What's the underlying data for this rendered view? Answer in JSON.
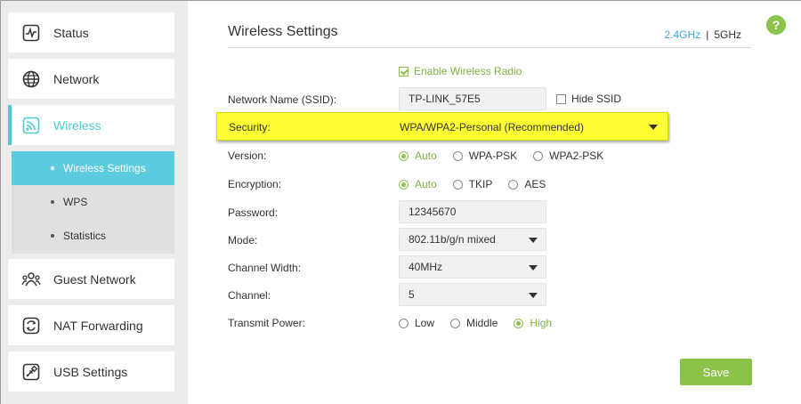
{
  "sidebar": {
    "items": [
      {
        "label": "Status",
        "icon": "status-icon"
      },
      {
        "label": "Network",
        "icon": "globe-icon"
      },
      {
        "label": "Wireless",
        "icon": "wifi-icon"
      },
      {
        "label": "Guest Network",
        "icon": "guest-icon"
      },
      {
        "label": "NAT Forwarding",
        "icon": "nat-icon"
      },
      {
        "label": "USB Settings",
        "icon": "usb-icon"
      }
    ],
    "submenu": [
      {
        "label": "Wireless Settings"
      },
      {
        "label": "WPS"
      },
      {
        "label": "Statistics"
      }
    ]
  },
  "header": {
    "title": "Wireless Settings",
    "band_24": "2.4GHz",
    "band_sep": "|",
    "band_5": "5GHz",
    "help": "?"
  },
  "form": {
    "enable_wireless": "Enable Wireless Radio",
    "ssid_label": "Network Name (SSID):",
    "ssid_value": "TP-LINK_57E5",
    "hide_ssid": "Hide SSID",
    "security_label": "Security:",
    "security_value": "WPA/WPA2-Personal (Recommended)",
    "version_label": "Version:",
    "version_options": [
      "Auto",
      "WPA-PSK",
      "WPA2-PSK"
    ],
    "encryption_label": "Encryption:",
    "encryption_options": [
      "Auto",
      "TKIP",
      "AES"
    ],
    "password_label": "Password:",
    "password_value": "12345670",
    "mode_label": "Mode:",
    "mode_value": "802.11b/g/n mixed",
    "channel_width_label": "Channel Width:",
    "channel_width_value": "40MHz",
    "channel_label": "Channel:",
    "channel_value": "5",
    "power_label": "Transmit Power:",
    "power_options": [
      "Low",
      "Middle",
      "High"
    ]
  },
  "save_label": "Save",
  "colors": {
    "accent": "#4acbd6",
    "green": "#8bc34a",
    "highlight": "#ffff33",
    "link": "#3fa8d8"
  }
}
